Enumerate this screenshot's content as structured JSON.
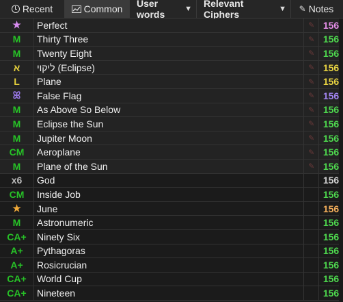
{
  "tabs": {
    "recent": "Recent",
    "common": "Common",
    "user_words": "User words",
    "relevant_ciphers": "Relevant Ciphers",
    "notes": "Notes",
    "chevron": "▼"
  },
  "rows": [
    {
      "icon": "★",
      "icon_color": "#d98cf0",
      "word": "Perfect",
      "pin": true,
      "value": "156",
      "value_color": "#e58ee8",
      "bg": "alt"
    },
    {
      "icon": "M",
      "icon_color": "#27c227",
      "word": "Thirty Three",
      "pin": true,
      "value": "156",
      "value_color": "#4ed84e",
      "bg": "alt"
    },
    {
      "icon": "M",
      "icon_color": "#27c227",
      "word": "Twenty Eight",
      "pin": true,
      "value": "156",
      "value_color": "#4ed84e",
      "bg": "alt"
    },
    {
      "icon": "א",
      "icon_color": "#e4cf3c",
      "word": "ליקוי (Eclipse)",
      "pin": true,
      "value": "156",
      "value_color": "#e8d342",
      "bg": "alt"
    },
    {
      "icon": "L",
      "icon_color": "#e4cf3c",
      "word": "Plane",
      "pin": true,
      "value": "156",
      "value_color": "#e8d342",
      "bg": "alt"
    },
    {
      "icon": "ꕤ",
      "icon_color": "#9a78e8",
      "word": "False Flag",
      "pin": true,
      "value": "156",
      "value_color": "#a184f0",
      "bg": "alt"
    },
    {
      "icon": "M",
      "icon_color": "#27c227",
      "word": "As Above So Below",
      "pin": true,
      "value": "156",
      "value_color": "#4ed84e",
      "bg": "alt"
    },
    {
      "icon": "M",
      "icon_color": "#27c227",
      "word": "Eclipse the Sun",
      "pin": true,
      "value": "156",
      "value_color": "#4ed84e",
      "bg": "alt"
    },
    {
      "icon": "M",
      "icon_color": "#27c227",
      "word": "Jupiter Moon",
      "pin": true,
      "value": "156",
      "value_color": "#4ed84e",
      "bg": "alt"
    },
    {
      "icon": "CM",
      "icon_color": "#27c227",
      "word": "Aeroplane",
      "pin": true,
      "value": "156",
      "value_color": "#4ed84e",
      "bg": "alt"
    },
    {
      "icon": "M",
      "icon_color": "#27c227",
      "word": "Plane of the Sun",
      "pin": true,
      "value": "156",
      "value_color": "#4ed84e",
      "bg": "alt"
    },
    {
      "icon": "x6",
      "icon_color": "#b8b8b8",
      "word": "God",
      "pin": false,
      "value": "156",
      "value_color": "#cfcfcf",
      "bg": "plain"
    },
    {
      "icon": "CM",
      "icon_color": "#27c227",
      "word": "Inside Job",
      "pin": false,
      "value": "156",
      "value_color": "#4ed84e",
      "bg": "plain"
    },
    {
      "icon": "★",
      "icon_color": "#f0a938",
      "word": "June",
      "pin": false,
      "value": "156",
      "value_color": "#f2ad5a",
      "bg": "plain"
    },
    {
      "icon": "M",
      "icon_color": "#27c227",
      "word": "Astronumeric",
      "pin": false,
      "value": "156",
      "value_color": "#4ed84e",
      "bg": "plain"
    },
    {
      "icon": "CA+",
      "icon_color": "#27c227",
      "word": "Ninety Six",
      "pin": false,
      "value": "156",
      "value_color": "#4ed84e",
      "bg": "plain"
    },
    {
      "icon": "A+",
      "icon_color": "#27c227",
      "word": "Pythagoras",
      "pin": false,
      "value": "156",
      "value_color": "#4ed84e",
      "bg": "plain"
    },
    {
      "icon": "A+",
      "icon_color": "#27c227",
      "word": "Rosicrucian",
      "pin": false,
      "value": "156",
      "value_color": "#4ed84e",
      "bg": "plain"
    },
    {
      "icon": "CA+",
      "icon_color": "#27c227",
      "word": "World Cup",
      "pin": false,
      "value": "156",
      "value_color": "#4ed84e",
      "bg": "plain"
    },
    {
      "icon": "CA+",
      "icon_color": "#27c227",
      "word": "Nineteen",
      "pin": false,
      "value": "156",
      "value_color": "#4ed84e",
      "bg": "plain"
    }
  ]
}
